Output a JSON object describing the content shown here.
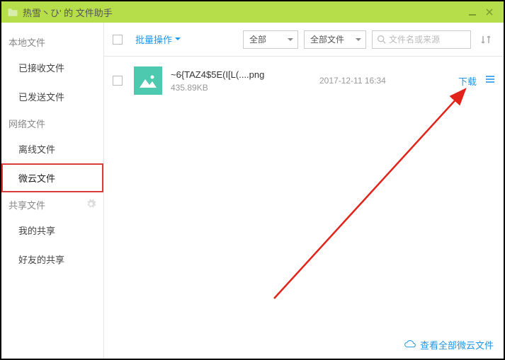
{
  "titlebar": {
    "title": "热雪丶ひ' 的 文件助手"
  },
  "sidebar": {
    "sections": [
      {
        "label": "本地文件",
        "items": [
          "已接收文件",
          "已发送文件"
        ]
      },
      {
        "label": "网络文件",
        "items": [
          "离线文件",
          "微云文件"
        ]
      },
      {
        "label": "共享文件",
        "items": [
          "我的共享",
          "好友的共享"
        ]
      }
    ]
  },
  "toolbar": {
    "batch_label": "批量操作",
    "filter1": "全部",
    "filter2": "全部文件",
    "search_placeholder": "文件名或来源"
  },
  "files": [
    {
      "name": "~6{TAZ4$5E(I[L(....png",
      "size": "435.89KB",
      "date": "2017-12-11 16:34",
      "download_label": "下载"
    }
  ],
  "footer": {
    "view_all": "查看全部微云文件"
  }
}
